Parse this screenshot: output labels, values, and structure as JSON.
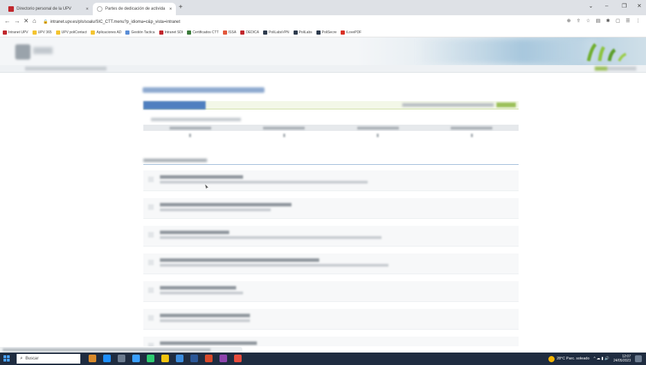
{
  "browser": {
    "tabs": [
      {
        "title": "Directorio personal de la UPV",
        "favicon_color": "#c1272d",
        "active": false
      },
      {
        "title": "Partes de dedicación de activida",
        "favicon_color": "#ffffff",
        "active": true
      }
    ],
    "new_tab": "+",
    "tab_close": "×",
    "window_controls": {
      "chevron": "⌄",
      "minimize": "–",
      "restore": "❐",
      "close": "✕"
    },
    "nav": {
      "back": "←",
      "forward": "→",
      "stop": "✕",
      "home": "⌂"
    },
    "address": "intranet.upv.es/pls/soalu/SIC_CTT.menu?p_idioma=c&p_vista=intranet",
    "toolbar_icons": [
      "⊕",
      "⇪",
      "☆",
      "▤",
      "✱",
      "▢",
      "☰",
      "⋮"
    ],
    "bookmarks": [
      {
        "label": "Intranet UPV",
        "color": "#c1272d"
      },
      {
        "label": "UPV 365",
        "color": "#f4c430"
      },
      {
        "label": "UPV poliContact",
        "color": "#f4c430"
      },
      {
        "label": "Aplicaciones AD",
        "color": "#f4c430"
      },
      {
        "label": "Gestión Tactica",
        "color": "#5a8dd6"
      },
      {
        "label": "Intranet SDI",
        "color": "#c1272d"
      },
      {
        "label": "Certificados CTT",
        "color": "#3a7a3a"
      },
      {
        "label": "ISSA",
        "color": "#e2573b"
      },
      {
        "label": "DEDICA",
        "color": "#c1272d"
      },
      {
        "label": "PoliLabsVPN",
        "color": "#2e3b4e"
      },
      {
        "label": "PoliLabs",
        "color": "#2e3b4e"
      },
      {
        "label": "PoliSecre",
        "color": "#2e3b4e"
      },
      {
        "label": "iLovePDF",
        "color": "#d93025"
      }
    ]
  },
  "taskbar": {
    "search_placeholder": "Buscar",
    "search_icon": "⌕",
    "apps": [
      "#d98a2b",
      "#1e90ff",
      "#6b7b8f",
      "#3aa0ff",
      "#2ecc71",
      "#f1c40f",
      "#3c8dde",
      "#2b5797",
      "#d84a2b",
      "#8e44ad",
      "#e74c3c"
    ],
    "weather": "28°C  Parc. soleado",
    "tray_icons": "^ ☁ ▮ 🔊",
    "time": "12:07",
    "date": "24/05/2023"
  }
}
